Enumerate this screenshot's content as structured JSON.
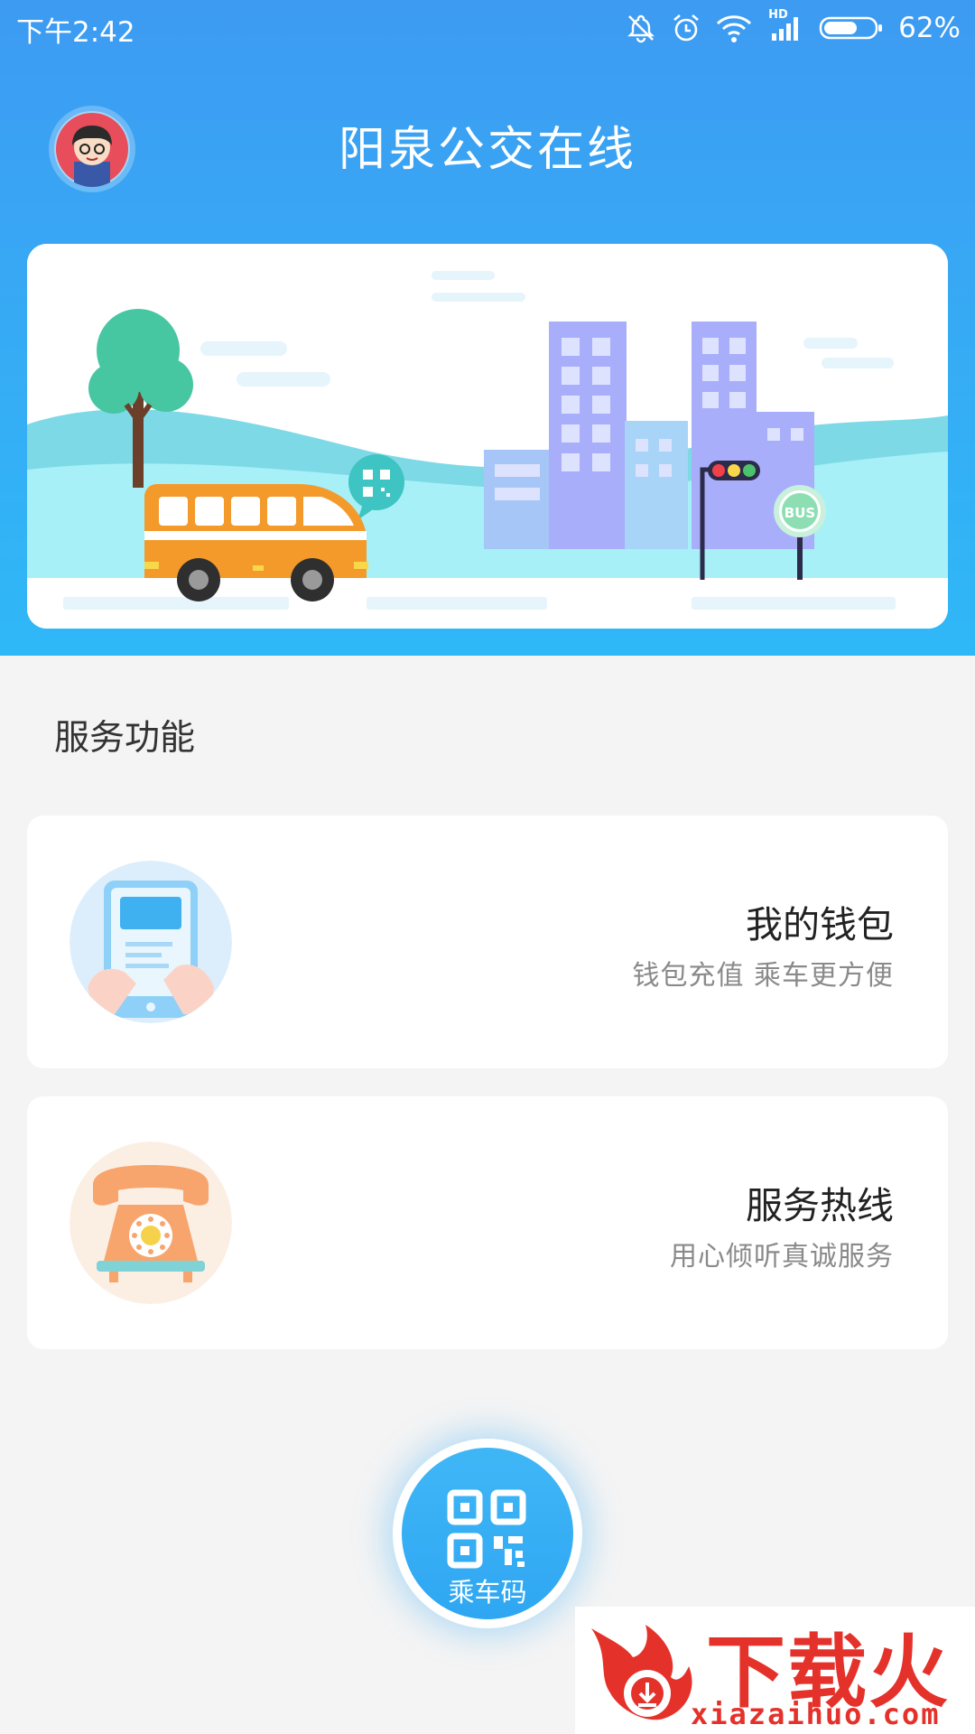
{
  "status_bar": {
    "time": "下午2:42",
    "network_badge": "HD",
    "battery_percent": "62%",
    "icons": [
      "mute-icon",
      "alarm-icon",
      "wifi-icon",
      "signal-icon",
      "battery-icon"
    ]
  },
  "header": {
    "title": "阳泉公交在线",
    "avatar_icon": "user-avatar",
    "background_colors": [
      "#3d9bf2",
      "#2fb8f7"
    ]
  },
  "banner": {
    "qr_bubble_icon": "qr-code-icon",
    "bus_sign": "BUS"
  },
  "services": {
    "section_title": "服务功能",
    "items": [
      {
        "title": "我的钱包",
        "subtitle": "钱包充值 乘车更方便",
        "icon": "wallet-phone-icon"
      },
      {
        "title": "服务热线",
        "subtitle": "用心倾听真诚服务",
        "icon": "telephone-icon"
      }
    ]
  },
  "ride_code": {
    "label": "乘车码",
    "icon": "qr-code-icon",
    "accent": "#36acf5"
  },
  "watermark": {
    "brand": "下载火",
    "url": "xiazaihuo.com",
    "color": "#e4322b"
  }
}
